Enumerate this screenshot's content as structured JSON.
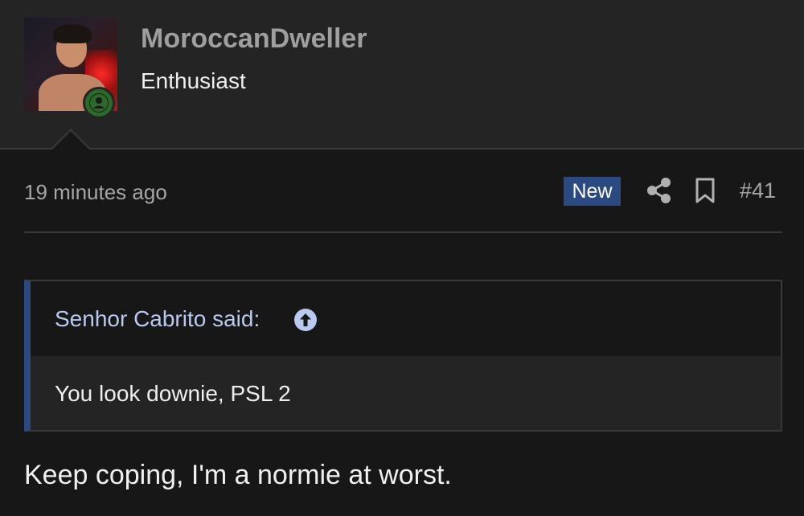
{
  "user": {
    "name": "MoroccanDweller",
    "title": "Enthusiast",
    "online_icon": "user-online-icon"
  },
  "post": {
    "time": "19 minutes ago",
    "new_label": "New",
    "share_icon": "share-icon",
    "bookmark_icon": "bookmark-icon",
    "number": "#41",
    "body": "Keep coping, I'm a normie at worst."
  },
  "quote": {
    "author_text": "Senhor Cabrito said:",
    "jump_icon": "arrow-up-circle-icon",
    "body": "You look downie, PSL 2"
  },
  "colors": {
    "background": "#171717",
    "header_bg": "#242424",
    "accent": "#2c4a82",
    "quote_author": "#b9c9ef",
    "online_green": "#2a6b2a"
  }
}
